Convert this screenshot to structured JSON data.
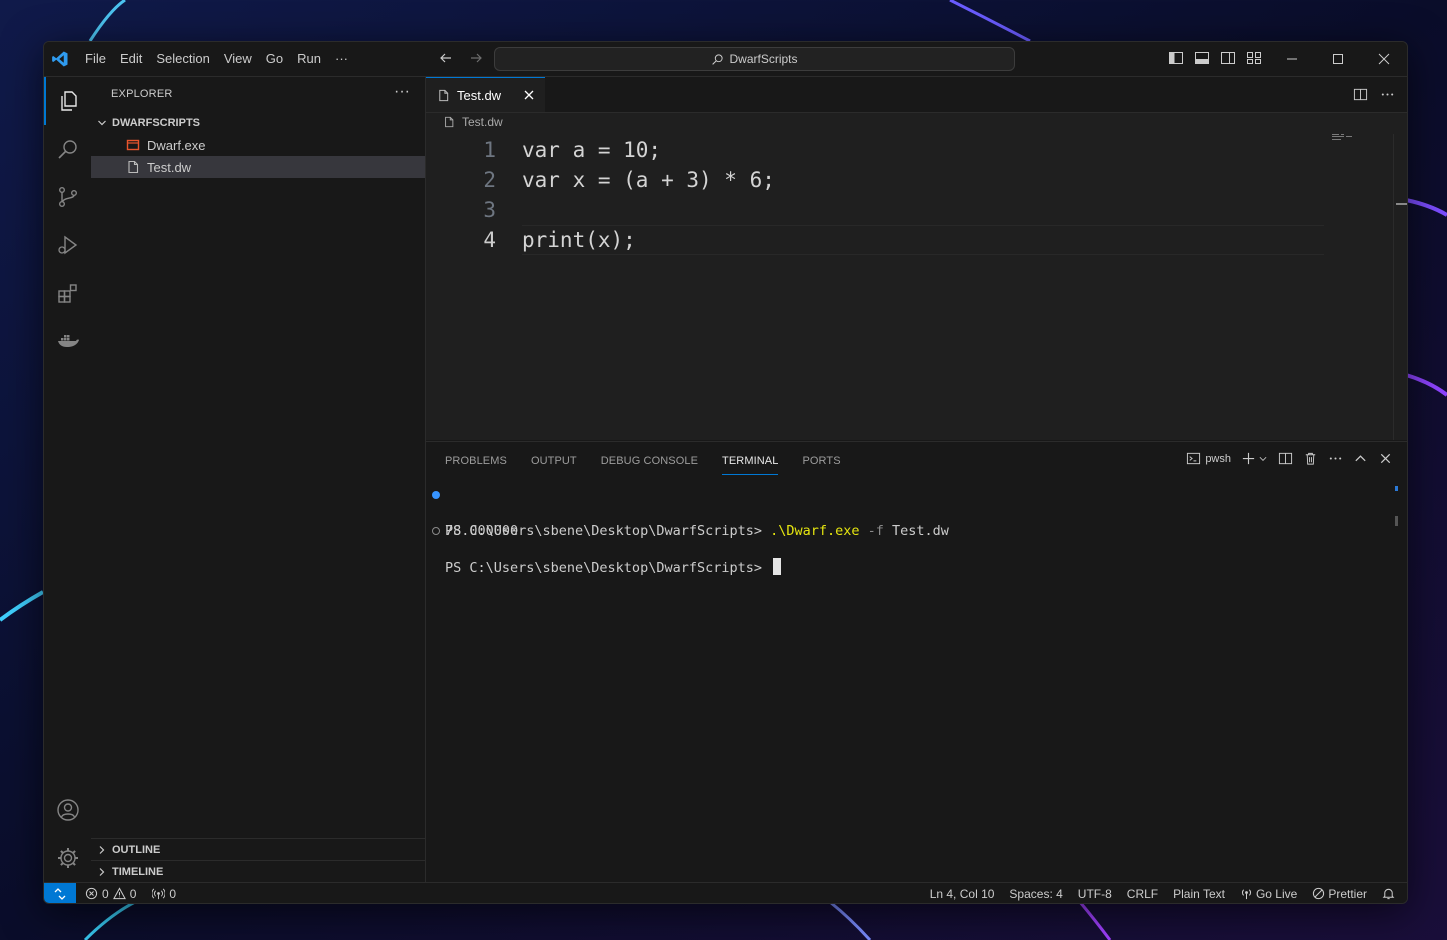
{
  "window": {
    "command_center": "DwarfScripts"
  },
  "menu": {
    "items": [
      "File",
      "Edit",
      "Selection",
      "View",
      "Go",
      "Run",
      "···"
    ]
  },
  "sidebar": {
    "title": "EXPLORER",
    "more": "···",
    "folder": "DWARFSCRIPTS",
    "files": [
      {
        "name": "Dwarf.exe",
        "icon": "exe-file-icon"
      },
      {
        "name": "Test.dw",
        "icon": "text-file-icon",
        "selected": true
      }
    ],
    "outline": "OUTLINE",
    "timeline": "TIMELINE"
  },
  "editor": {
    "tab_label": "Test.dw",
    "breadcrumb": "Test.dw",
    "line_numbers": [
      "1",
      "2",
      "3",
      "4"
    ],
    "lines": [
      "var a = 10;",
      "var x = (a + 3) * 6;",
      "",
      "print(x);"
    ],
    "current_line": 4
  },
  "panel": {
    "tabs": [
      "PROBLEMS",
      "OUTPUT",
      "DEBUG CONSOLE",
      "TERMINAL",
      "PORTS"
    ],
    "active_tab": "TERMINAL",
    "shell": "pwsh",
    "terminal": {
      "prompt1": "PS C:\\Users\\sbene\\Desktop\\DwarfScripts> ",
      "cmd_exe": ".\\Dwarf.exe",
      "cmd_flag": " -f ",
      "cmd_arg": "Test.dw",
      "output": "78.000000",
      "prompt2": "PS C:\\Users\\sbene\\Desktop\\DwarfScripts> "
    }
  },
  "status": {
    "errors": "0",
    "warnings": "0",
    "ports": "0",
    "position": "Ln 4, Col 10",
    "spaces": "Spaces: 4",
    "encoding": "UTF-8",
    "eol": "CRLF",
    "language": "Plain Text",
    "golive": "Go Live",
    "prettier": "Prettier"
  },
  "colors": {
    "accent": "#0078d4",
    "bg": "#181818",
    "editor_bg": "#1f1f1f"
  }
}
